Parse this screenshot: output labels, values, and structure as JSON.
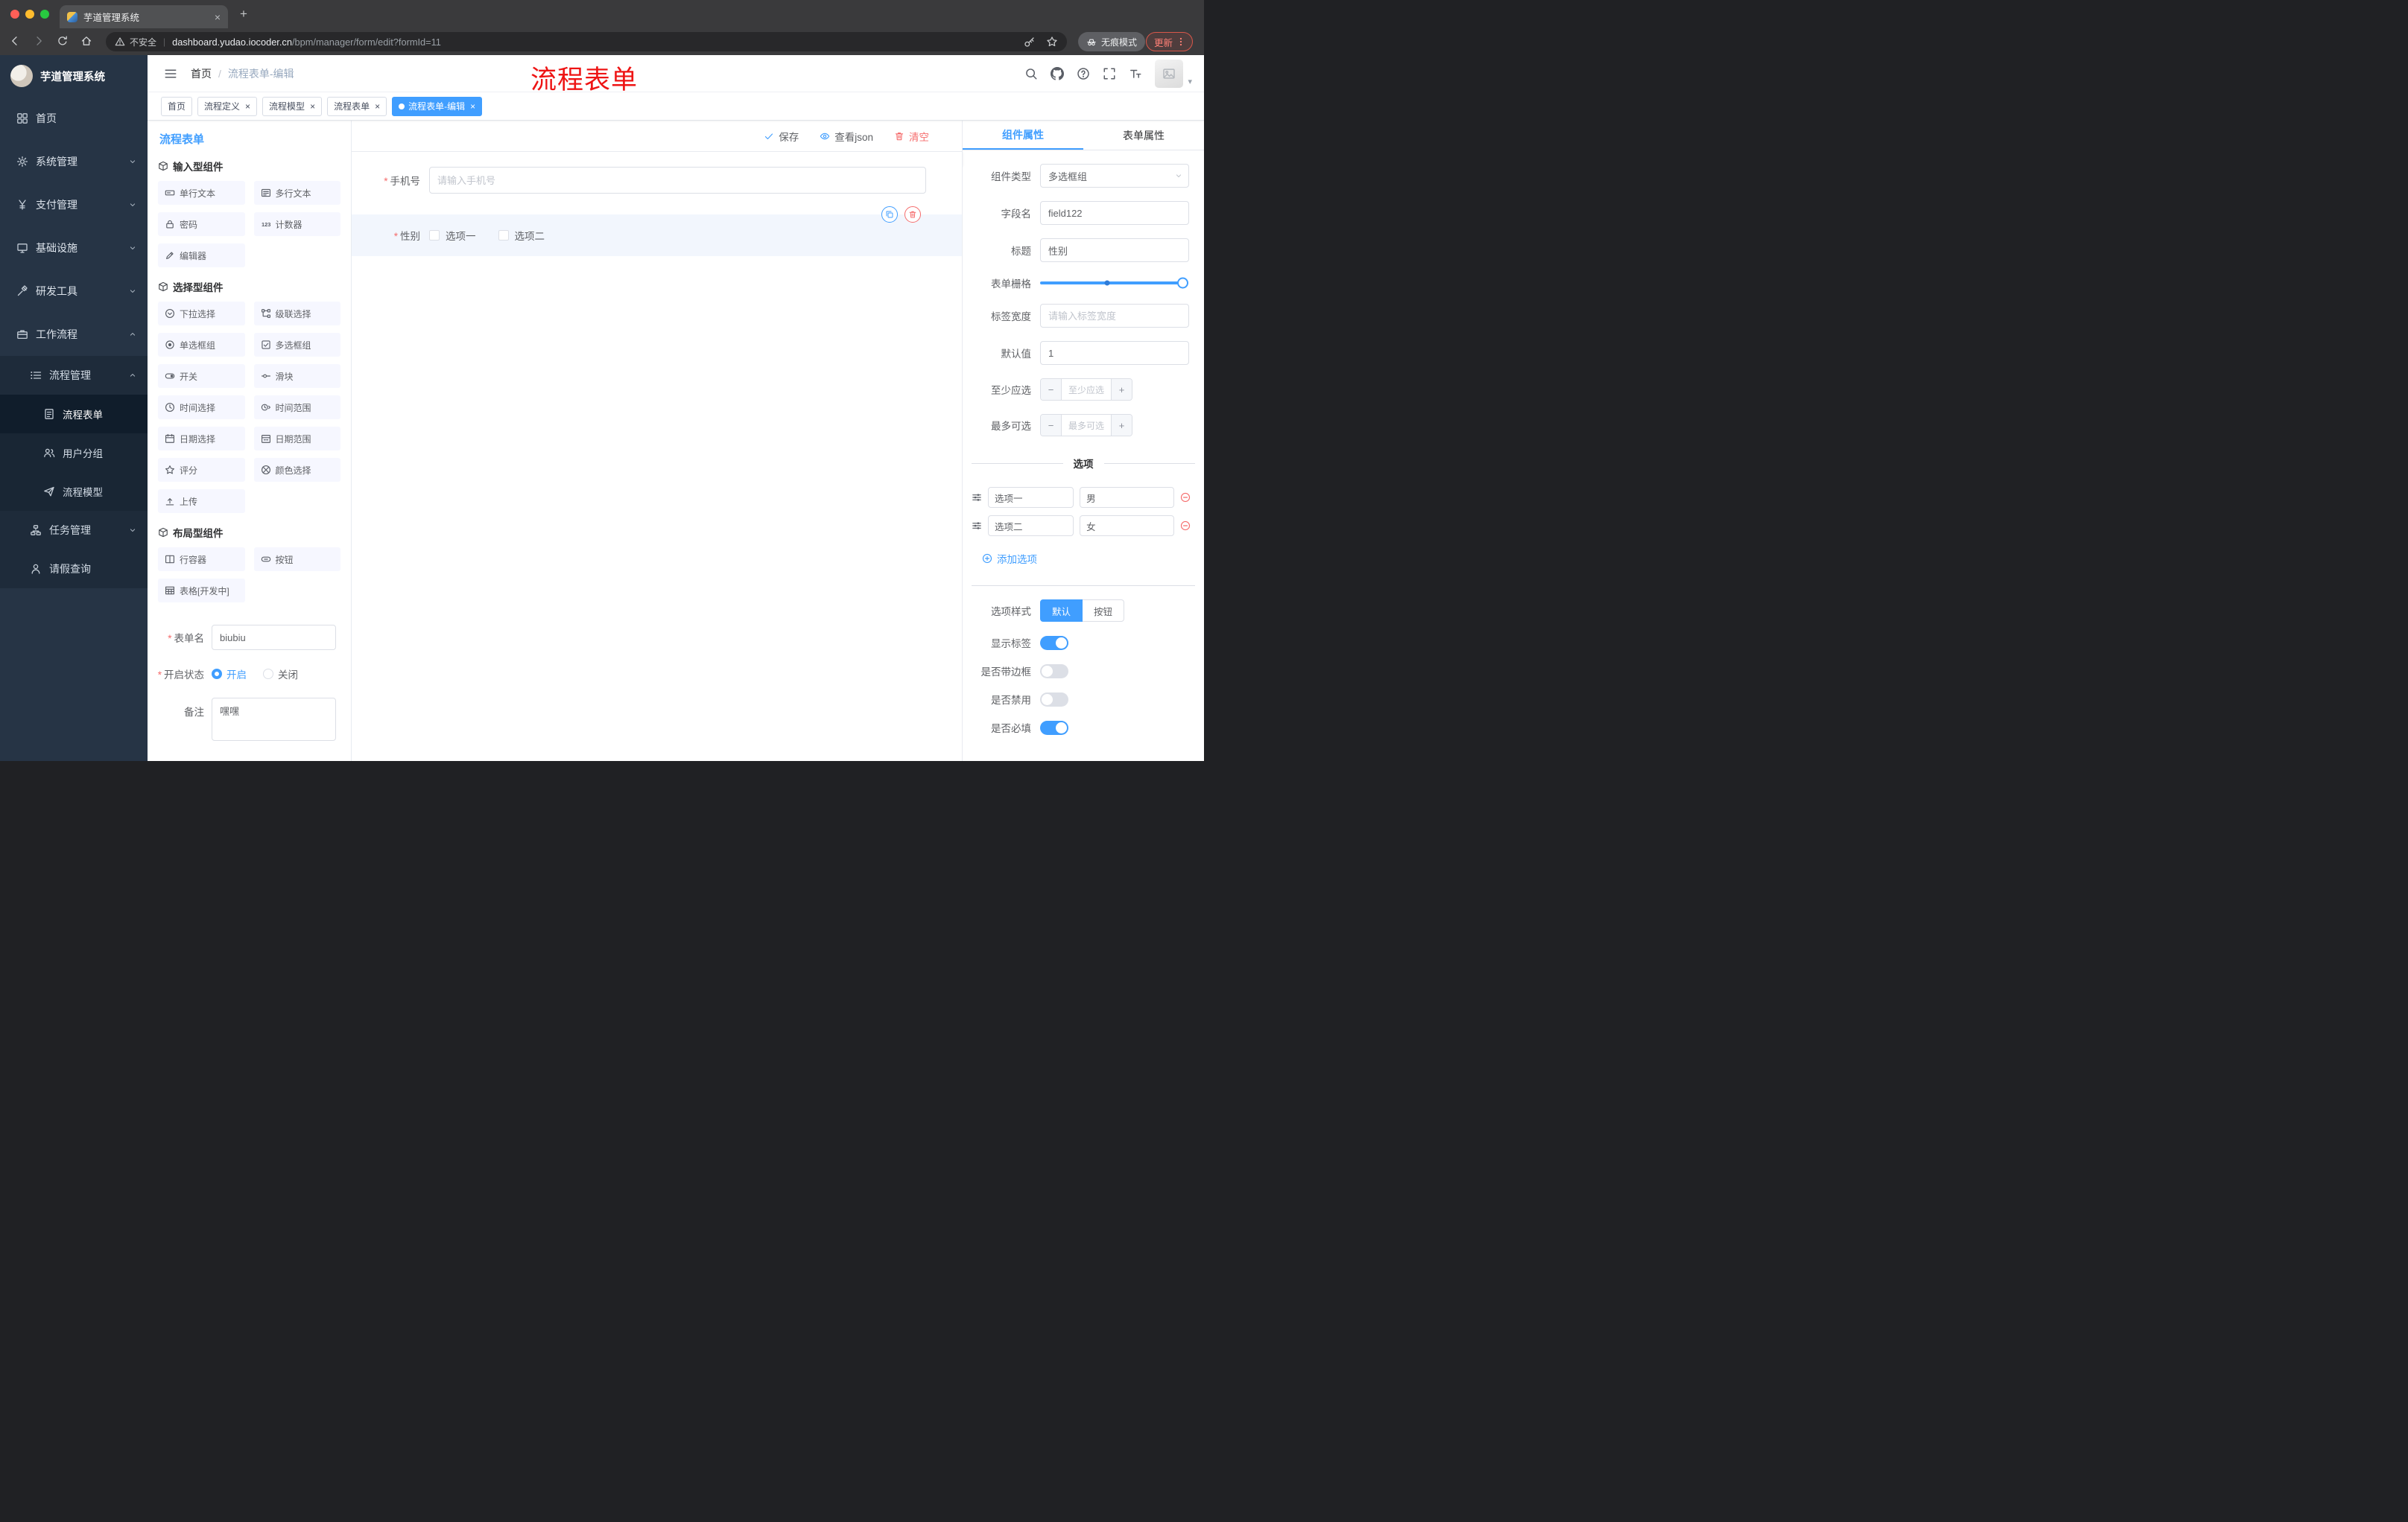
{
  "glyphs": {
    "close": "×",
    "plus": "+",
    "minus": "−",
    "dots": "⋮",
    "caret_down": "▾",
    "pipe": "|",
    "slash": "/",
    "asterisk": "*"
  },
  "colors": {
    "accent": "#409eff",
    "danger": "#f56c6c",
    "annotation_red": "#ee1414",
    "sidebar_bg": "#263445"
  },
  "browser": {
    "tab_title": "芋道管理系统",
    "security_text": "不安全",
    "url_host": "dashboard.yudao.iocoder.cn",
    "url_path": "/bpm/manager/form/edit?formId=11",
    "incognito_label": "无痕模式",
    "update_label": "更新"
  },
  "sidebar": {
    "logo_title": "芋道管理系统",
    "items": [
      {
        "label": "首页"
      },
      {
        "label": "系统管理"
      },
      {
        "label": "支付管理"
      },
      {
        "label": "基础设施"
      },
      {
        "label": "研发工具"
      },
      {
        "label": "工作流程"
      },
      {
        "label": "流程管理"
      },
      {
        "label": "流程表单"
      },
      {
        "label": "用户分组"
      },
      {
        "label": "流程模型"
      },
      {
        "label": "任务管理"
      },
      {
        "label": "请假查询"
      }
    ]
  },
  "header": {
    "breadcrumb_home": "首页",
    "breadcrumb_current": "流程表单-编辑",
    "overlay_title": "流程表单"
  },
  "tags": [
    {
      "label": "首页"
    },
    {
      "label": "流程定义"
    },
    {
      "label": "流程模型"
    },
    {
      "label": "流程表单"
    },
    {
      "label": "流程表单-编辑"
    }
  ],
  "palette": {
    "title": "流程表单",
    "sections": [
      {
        "title": "输入型组件",
        "items": [
          "单行文本",
          "多行文本",
          "密码",
          "计数器",
          "编辑器"
        ]
      },
      {
        "title": "选择型组件",
        "items": [
          "下拉选择",
          "级联选择",
          "单选框组",
          "多选框组",
          "开关",
          "滑块",
          "时间选择",
          "时间范围",
          "日期选择",
          "日期范围",
          "评分",
          "颜色选择",
          "上传"
        ]
      },
      {
        "title": "布局型组件",
        "items": [
          "行容器",
          "按钮",
          "表格[开发中]"
        ]
      }
    ],
    "form": {
      "name_label": "表单名",
      "name_value": "biubiu",
      "status_label": "开启状态",
      "status_on": "开启",
      "status_off": "关闭",
      "remark_label": "备注",
      "remark_value": "嘿嘿"
    }
  },
  "canvas": {
    "save": "保存",
    "view_json": "查看json",
    "clear": "清空",
    "phone_label": "手机号",
    "phone_placeholder": "请输入手机号",
    "gender_label": "性别",
    "gender_opt1": "选项一",
    "gender_opt2": "选项二"
  },
  "inspector": {
    "tab_component": "组件属性",
    "tab_form": "表单属性",
    "component_type_label": "组件类型",
    "component_type_value": "多选框组",
    "field_label": "字段名",
    "field_value": "field122",
    "title_label": "标题",
    "title_value": "性别",
    "grid_label": "表单栅格",
    "label_width_label": "标签宽度",
    "label_width_placeholder": "请输入标签宽度",
    "default_label": "默认值",
    "default_value": "1",
    "min_label": "至少应选",
    "min_placeholder": "至少应选",
    "max_label": "最多可选",
    "max_placeholder": "最多可选",
    "options_title": "选项",
    "options": [
      {
        "label": "选项一",
        "value": "男"
      },
      {
        "label": "选项二",
        "value": "女"
      }
    ],
    "add_option": "添加选项",
    "style_label": "选项样式",
    "style_default": "默认",
    "style_button": "按钮",
    "switch_show_label": "显示标签",
    "switch_border": "是否带边框",
    "switch_disabled": "是否禁用",
    "switch_required": "是否必填"
  }
}
